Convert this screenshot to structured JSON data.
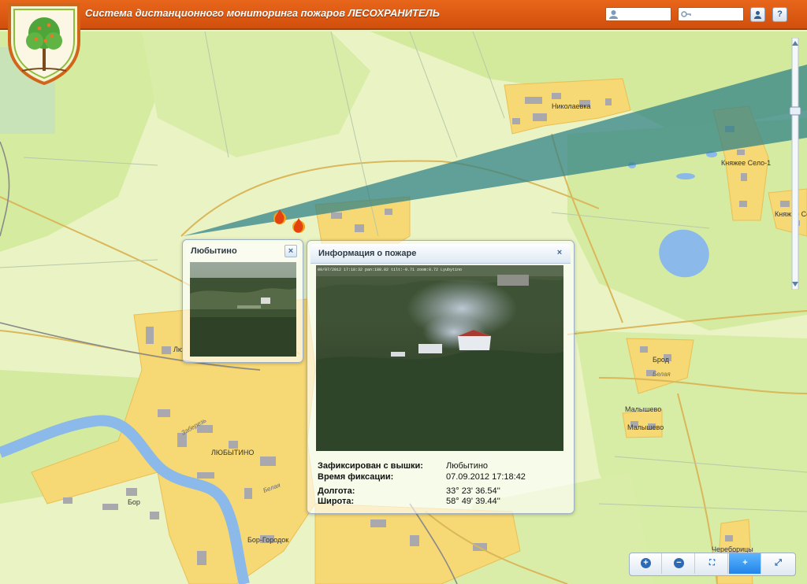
{
  "header": {
    "title": "Система дистанционного мониторинга пожаров ЛЕСОХРАНИТЕЛЬ",
    "user_field_value": "",
    "password_field_value": "",
    "login_button_icon": "user-icon",
    "help_label": "?"
  },
  "map": {
    "places": {
      "nikolaevka": "Николаевка",
      "knyazhee_selo_1": "Княжее Село-1",
      "knyazhee_selo_2": "Княжее Се",
      "lyubytino_left": "Лю",
      "lyubytino": "ЛЮБЫТИНО",
      "brod": "Брод",
      "malyshevo_1": "Малышево",
      "malyshevo_2": "Малышево",
      "bor": "Бор",
      "bor_gorodok": "Бор-Городок",
      "cherenoritsy": "Череборицы"
    },
    "roads": {
      "belaya_1": "Белая",
      "belaya_2": "Белая",
      "zabereg": "Заберезь"
    }
  },
  "camera_popup": {
    "title": "Любытино",
    "close": "×"
  },
  "fire_popup": {
    "title": "Информация о пожаре",
    "close": "×",
    "overlay_text": "09/07/2012 17:18:32  pan:188.82  tilt:-0.71  zoom:8.72  Lyubytino",
    "rows": [
      {
        "label": "Зафиксирован с вышки:",
        "value": "Любытино"
      },
      {
        "label": "Время фиксации:",
        "value": "07.09.2012 17:18:42"
      },
      {
        "label": "Долгота:",
        "value": "33° 23' 36.54''"
      },
      {
        "label": "Широта:",
        "value": "58° 49' 39.44''"
      }
    ]
  },
  "toolbar": {
    "zoom_in": "+",
    "zoom_out": "−",
    "extent": "⛶",
    "pan": "+",
    "fullscreen": "⤢"
  },
  "colors": {
    "header": "#e0591a",
    "map_green": "#d9eca3",
    "river": "#9cc4ea",
    "beam": "#2e8a8a",
    "town": "#f7d56e"
  }
}
